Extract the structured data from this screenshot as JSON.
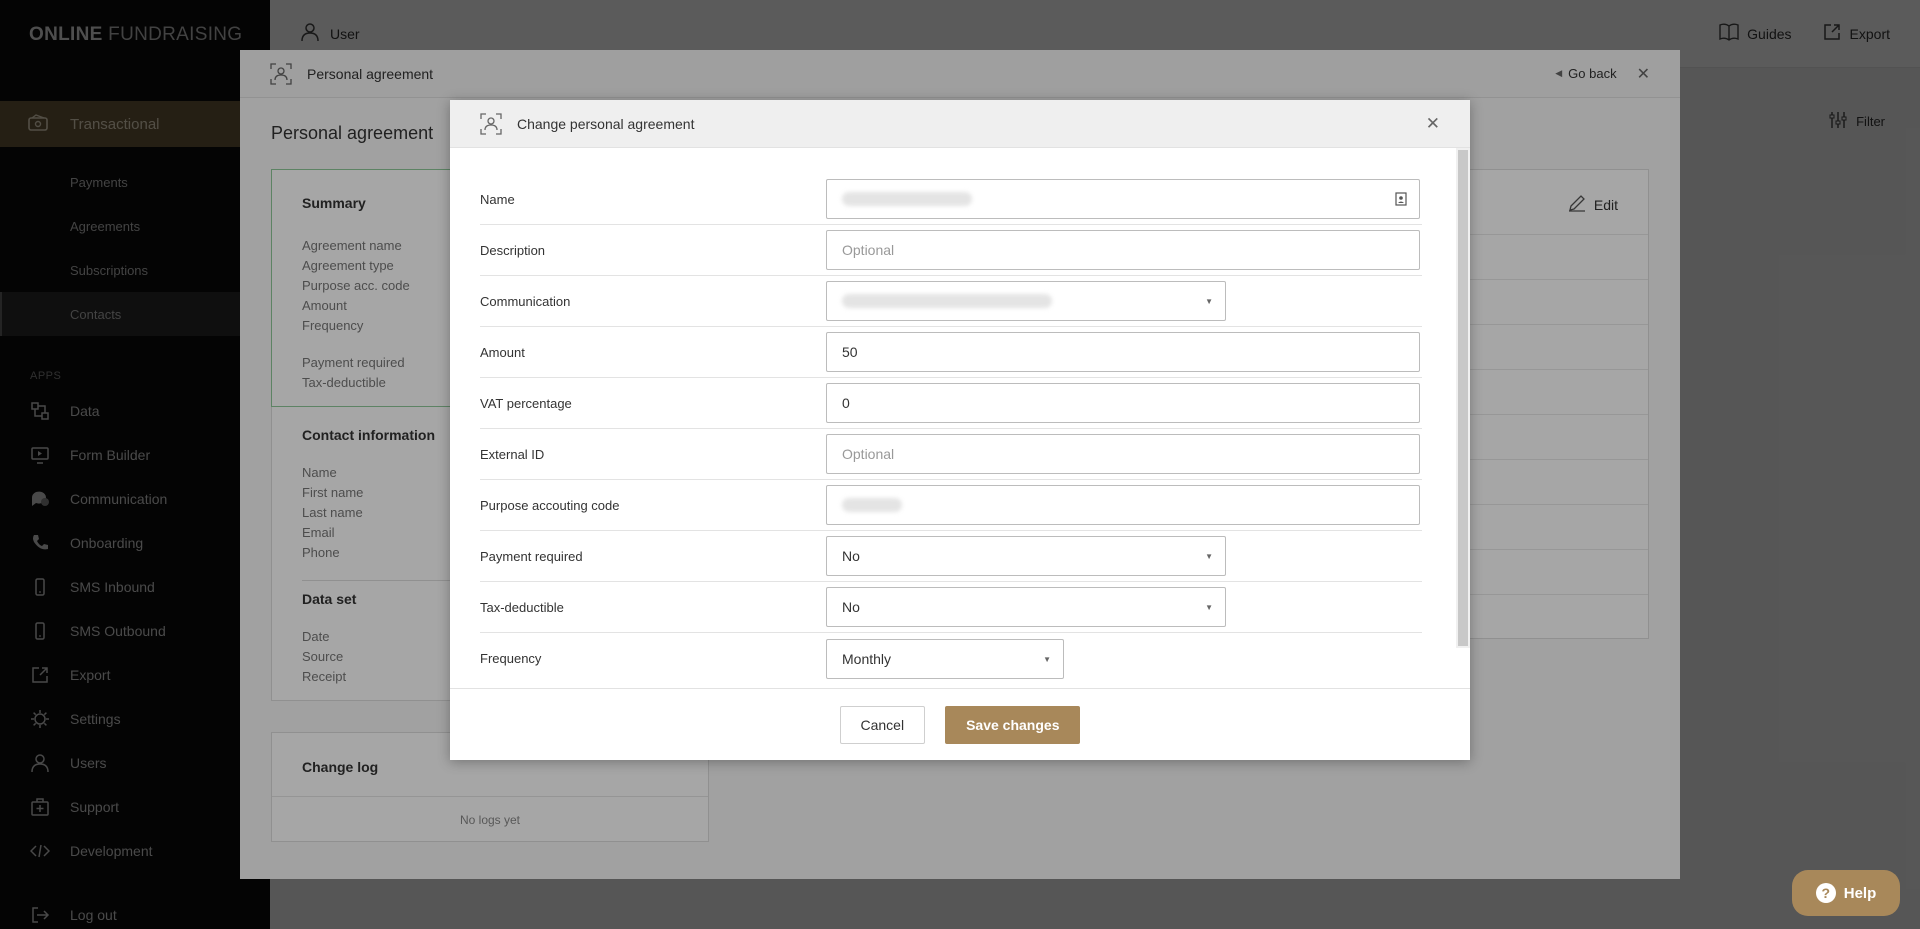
{
  "brand": {
    "bold": "ONLINE",
    "light": " FUNDRAISING"
  },
  "sidebar": {
    "active": "Transactional",
    "sub_items": [
      {
        "label": "Payments"
      },
      {
        "label": "Agreements"
      },
      {
        "label": "Subscriptions"
      },
      {
        "label": "Contacts"
      }
    ],
    "apps_heading": "APPS",
    "apps": [
      {
        "label": "Data",
        "icon": "data-icon"
      },
      {
        "label": "Form Builder",
        "icon": "form-builder-icon"
      },
      {
        "label": "Communication",
        "icon": "chat-icon"
      },
      {
        "label": "Onboarding",
        "icon": "phone-icon"
      },
      {
        "label": "SMS Inbound",
        "icon": "mobile-icon"
      },
      {
        "label": "SMS Outbound",
        "icon": "mobile-icon"
      },
      {
        "label": "Export",
        "icon": "export-icon"
      },
      {
        "label": "Settings",
        "icon": "gear-icon"
      },
      {
        "label": "Users",
        "icon": "user-icon"
      },
      {
        "label": "Support",
        "icon": "support-icon"
      },
      {
        "label": "Development",
        "icon": "code-icon"
      }
    ],
    "logout": "Log out"
  },
  "topbar": {
    "user": "User",
    "guides": "Guides",
    "export": "Export",
    "filter": "Filter"
  },
  "panel": {
    "title": "Personal agreement",
    "go_back": "Go back",
    "heading": "Personal agreement",
    "summary": {
      "title": "Summary",
      "fields": [
        "Agreement name",
        "Agreement type",
        "Purpose acc. code",
        "Amount",
        "Frequency"
      ],
      "fields2": [
        "Payment required",
        "Tax-deductible"
      ]
    },
    "contact": {
      "title": "Contact information",
      "fields": [
        "Name",
        "First name",
        "Last name",
        "Email",
        "Phone"
      ],
      "dataset_title": "Data set",
      "dataset_fields": [
        "Date",
        "Source",
        "Receipt"
      ]
    },
    "changelog": {
      "title": "Change log",
      "empty": "No logs yet"
    },
    "edit": "Edit"
  },
  "modal": {
    "title": "Change personal agreement",
    "fields": {
      "name": {
        "label": "Name"
      },
      "description": {
        "label": "Description",
        "placeholder": "Optional"
      },
      "communication": {
        "label": "Communication"
      },
      "amount": {
        "label": "Amount",
        "value": "50"
      },
      "vat": {
        "label": "VAT percentage",
        "value": "0"
      },
      "external_id": {
        "label": "External ID",
        "placeholder": "Optional"
      },
      "purpose": {
        "label": "Purpose accouting code"
      },
      "payment_required": {
        "label": "Payment required",
        "value": "No"
      },
      "tax_deductible": {
        "label": "Tax-deductible",
        "value": "No"
      },
      "frequency": {
        "label": "Frequency",
        "value": "Monthly"
      }
    },
    "cancel": "Cancel",
    "save": "Save changes"
  },
  "help": "Help"
}
